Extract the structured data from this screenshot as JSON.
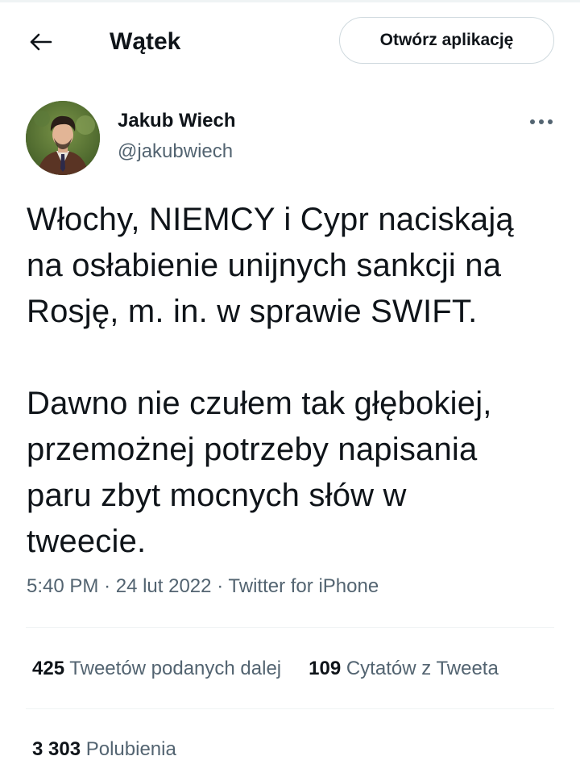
{
  "header": {
    "back_icon": "arrow-left-icon",
    "title": "Wątek",
    "open_app_label": "Otwórz aplikację"
  },
  "author": {
    "name": "Jakub Wiech",
    "handle": "@jakubwiech",
    "more_icon": "more-horizontal-icon"
  },
  "tweet": {
    "text": "Włochy, NIEMCY i Cypr naciskają\nna osłabienie unijnych sankcji na\nRosję, m. in. w sprawie SWIFT.\n\nDawno nie czułem tak głębokiej,\nprzemożnej potrzeby napisania\nparu zbyt mocnych słów w\ntweecie.",
    "time": "5:40 PM",
    "separator": "·",
    "date": "24 lut 2022",
    "source": "Twitter for iPhone"
  },
  "stats": {
    "retweets_count": "425",
    "retweets_label": "Tweetów podanych dalej",
    "quotes_count": "109",
    "quotes_label": "Cytatów z Tweeta",
    "likes_count": "3 303",
    "likes_label": "Polubienia"
  },
  "colors": {
    "text_primary": "#0f1419",
    "text_secondary": "#536471",
    "border": "#cfd9de",
    "divider": "#eff3f4"
  }
}
